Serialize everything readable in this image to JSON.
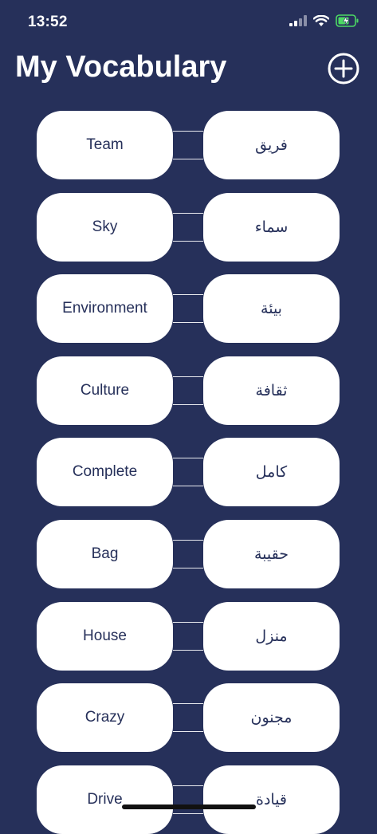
{
  "status_bar": {
    "time": "13:52",
    "icons": [
      "signal-icon",
      "wifi-icon",
      "battery-charging-icon"
    ]
  },
  "header": {
    "title": "My Vocabulary",
    "add_icon": "plus-circle-icon"
  },
  "colors": {
    "background": "#26305a",
    "card": "#ffffff",
    "card_text": "#26305a",
    "battery": "#4cd964"
  },
  "vocabulary": [
    {
      "english": "Team",
      "arabic": "فريق"
    },
    {
      "english": "Sky",
      "arabic": "سماء"
    },
    {
      "english": "Environment",
      "arabic": "بيئة"
    },
    {
      "english": "Culture",
      "arabic": "ثقافة"
    },
    {
      "english": "Complete",
      "arabic": "كامل"
    },
    {
      "english": "Bag",
      "arabic": "حقيبة"
    },
    {
      "english": "House",
      "arabic": "منزل"
    },
    {
      "english": "Crazy",
      "arabic": "مجنون"
    },
    {
      "english": "Drive",
      "arabic": "قيادة"
    }
  ]
}
